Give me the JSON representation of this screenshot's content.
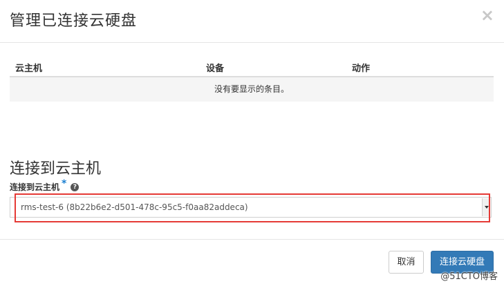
{
  "dialog": {
    "title": "管理已连接云硬盘",
    "close_symbol": "×"
  },
  "attachments_table": {
    "columns": [
      "云主机",
      "设备",
      "动作"
    ],
    "empty_message": "没有要显示的条目。"
  },
  "attach_section": {
    "title": "连接到云主机",
    "field_label": "连接到云主机",
    "required_marker": "*",
    "help_symbol": "?",
    "selected_instance": "rms-test-6 (8b22b6e2-d501-478c-95c5-f0aa82addeca)"
  },
  "footer": {
    "cancel_label": "取消",
    "submit_label": "连接云硬盘"
  },
  "watermark": "@51CTO博客",
  "colors": {
    "primary": "#337ab7",
    "highlight": "#e53935",
    "required": "#1a7fd1"
  }
}
